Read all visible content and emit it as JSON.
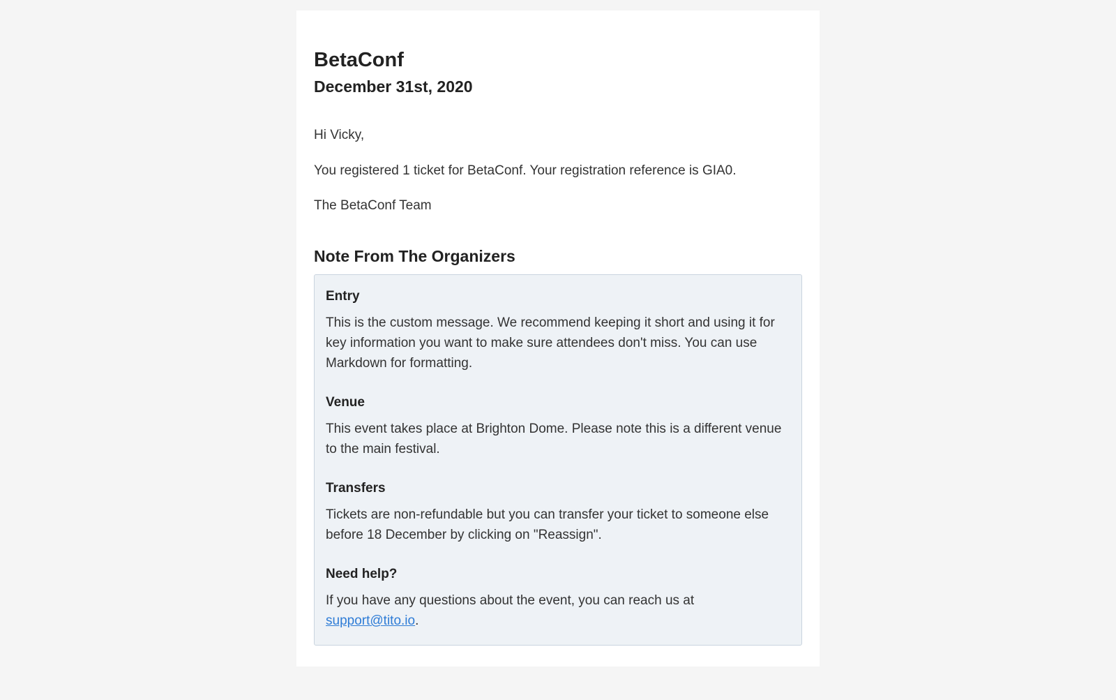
{
  "header": {
    "event_title": "BetaConf",
    "event_date": "December 31st, 2020"
  },
  "body": {
    "greeting": "Hi Vicky,",
    "confirmation": "You registered 1 ticket for BetaConf. Your registration reference is GIA0.",
    "signoff": "The BetaConf Team"
  },
  "note": {
    "heading": "Note From The Organizers",
    "sections": {
      "entry": {
        "title": "Entry",
        "text": "This is the custom message. We recommend keeping it short and using it for key information you want to make sure attendees don't miss. You can use Markdown for formatting."
      },
      "venue": {
        "title": "Venue",
        "text": "This event takes place at Brighton Dome. Please note this is a different venue to the main festival."
      },
      "transfers": {
        "title": "Transfers",
        "text": "Tickets are non-refundable but you can transfer your ticket to someone else before 18 December by clicking on \"Reassign\"."
      },
      "help": {
        "title": "Need help?",
        "prefix": "If you have any questions about the event, you can reach us at ",
        "link_text": "support@tito.io",
        "suffix": "."
      }
    }
  }
}
